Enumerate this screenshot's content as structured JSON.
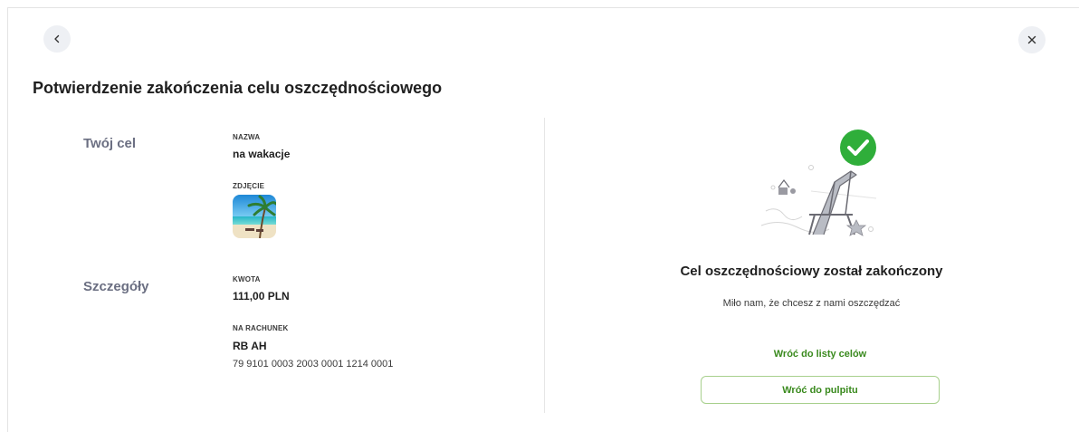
{
  "page": {
    "title": "Potwierdzenie zakończenia celu oszczędnościowego"
  },
  "nav": {
    "back_icon": "chevron-left-icon",
    "close_icon": "close-icon"
  },
  "goal": {
    "section_label": "Twój cel",
    "name_label": "NAZWA",
    "name_value": "na wakacje",
    "photo_label": "ZDJĘCIE",
    "photo_icon": "beach-photo"
  },
  "details": {
    "section_label": "Szczegóły",
    "amount_label": "KWOTA",
    "amount_value": "111,00 PLN",
    "account_label": "NA RACHUNEK",
    "account_name": "RB AH",
    "account_number": "79 9101 0003 2003 0001 1214 0001"
  },
  "success": {
    "illustration": "deck-chair-success-illustration",
    "title": "Cel oszczędnościowy został zakończony",
    "subtitle": "Miło nam, że chcesz z nami oszczędzać",
    "link_label": "Wróć do listy celów",
    "button_label": "Wróć do pulpitu"
  },
  "colors": {
    "accent_green": "#3a8a1e",
    "check_green": "#2fae3a",
    "section_label": "#6b6f82"
  }
}
